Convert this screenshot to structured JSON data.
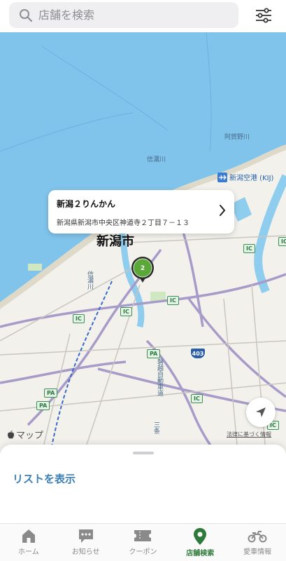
{
  "search": {
    "placeholder": "店舗を検索"
  },
  "map": {
    "labels": {
      "river_shinano": "信濃川",
      "river_agano": "阿賀野川",
      "river_shinano2": "信濃川",
      "airport": "新潟空港 (KIJ)",
      "city": "新潟市",
      "expressway": "磐越自動車道",
      "river_lower": "信濃川",
      "river_sanuki": "三条"
    },
    "ic_badge": "IC",
    "pa_badge": "PA",
    "route_number": "403",
    "callout": {
      "name": "新潟２りんかん",
      "address": "新潟県新潟市中央区神道寺２丁目７－１３"
    },
    "attribution": "マップ",
    "legal": "法律に基づく情報"
  },
  "sheet": {
    "list_button": "リストを表示"
  },
  "tabs": [
    {
      "label": "ホーム",
      "icon": "home-icon"
    },
    {
      "label": "お知らせ",
      "icon": "chat-icon"
    },
    {
      "label": "クーポン",
      "icon": "ticket-icon"
    },
    {
      "label": "店舗検索",
      "icon": "location-pin-icon",
      "active": true
    },
    {
      "label": "愛車情報",
      "icon": "motorcycle-icon"
    }
  ],
  "colors": {
    "accent": "#2d7a3a",
    "sea": "#7ec3ea",
    "link": "#3c7fb5"
  }
}
